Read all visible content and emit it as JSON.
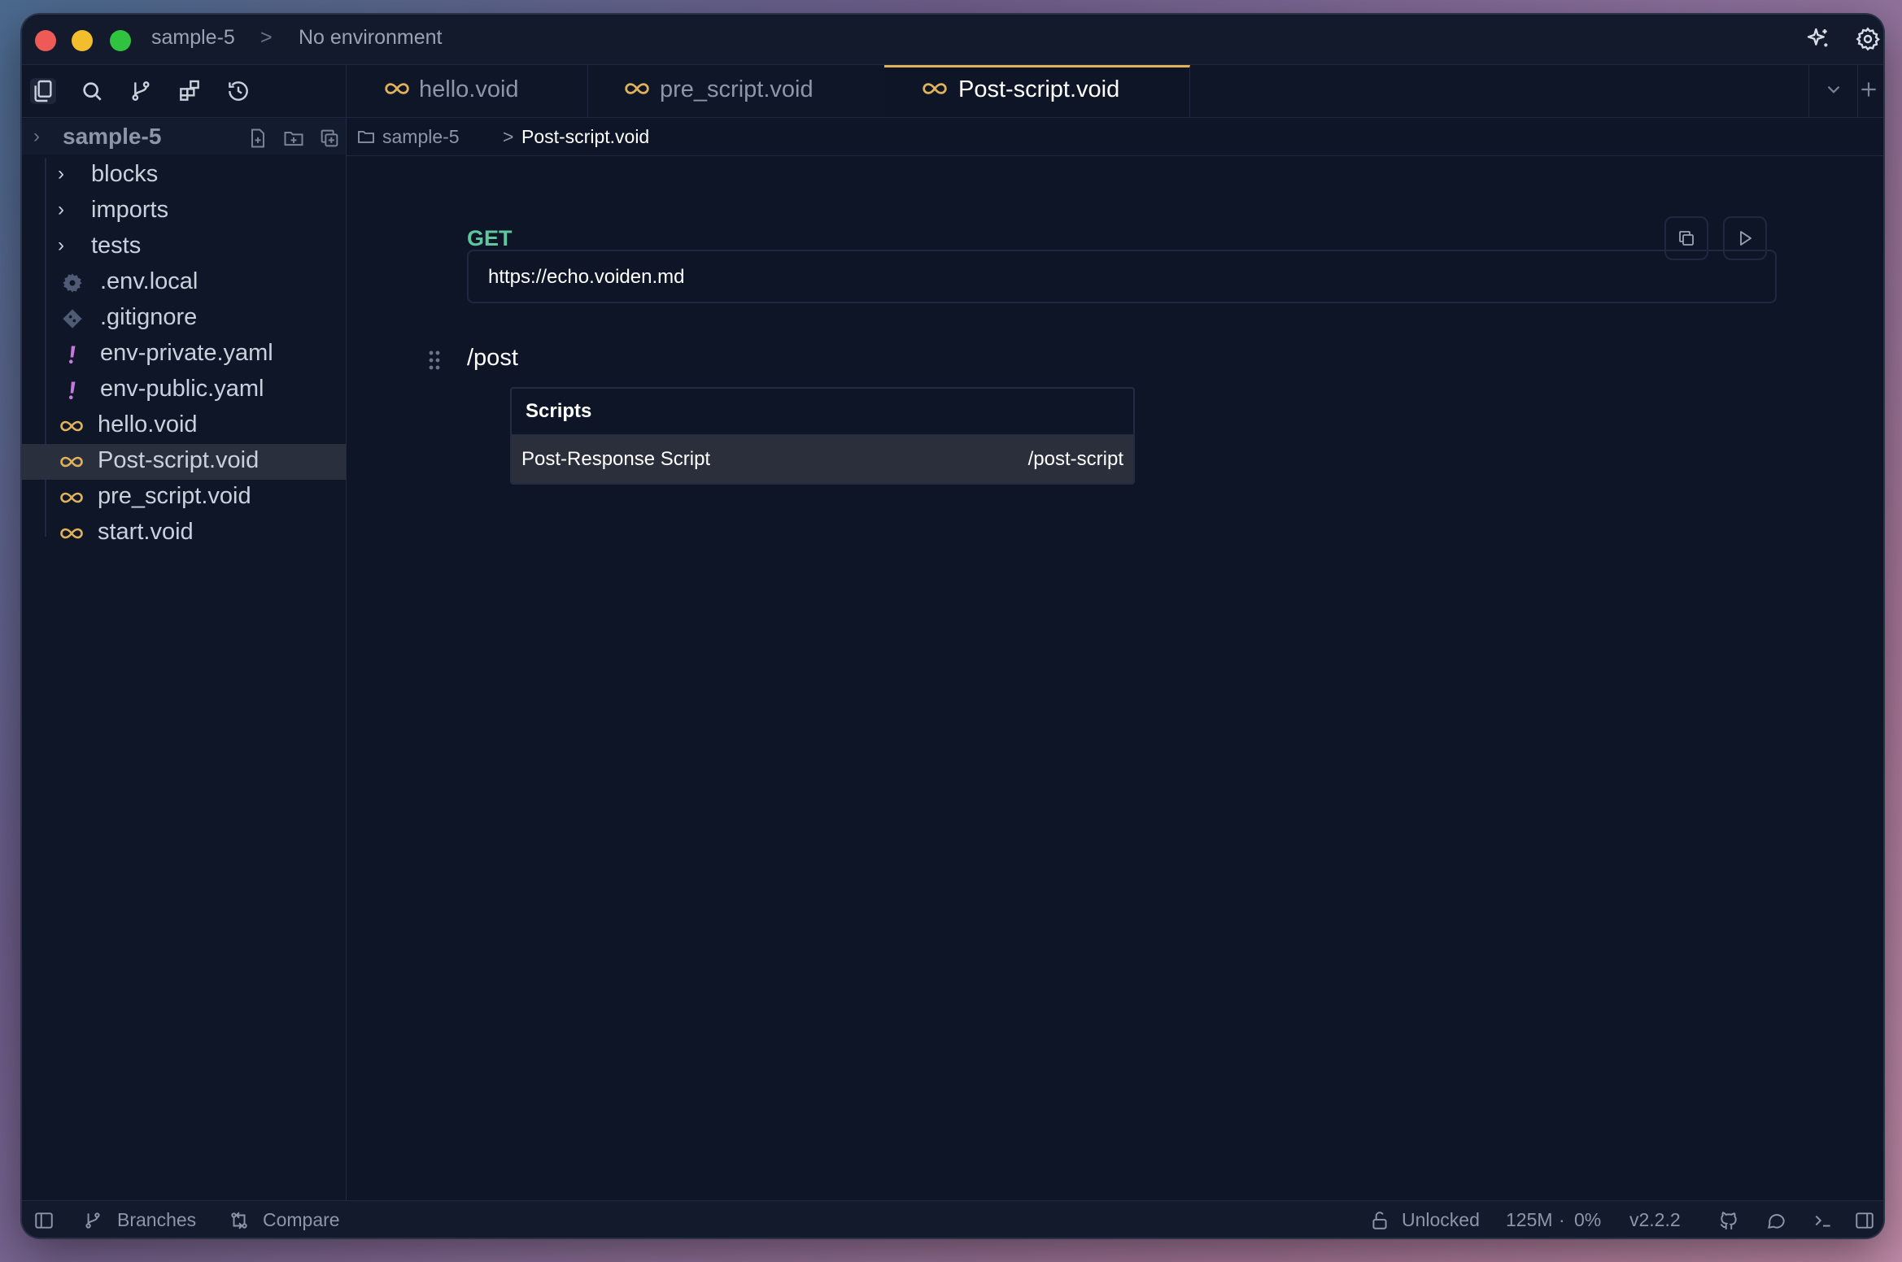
{
  "titlebar": {
    "project": "sample-5",
    "separator": ">",
    "environment": "No environment",
    "icons": [
      "sparkle-icon",
      "settings-gear-icon"
    ]
  },
  "activity_bar": {
    "icons": [
      "files-icon",
      "search-icon",
      "source-control-icon",
      "extensions-icon",
      "history-icon"
    ],
    "active": "files-icon"
  },
  "sidebar": {
    "project_name": "sample-5",
    "project_tools": [
      "new-file-icon",
      "new-folder-icon",
      "duplicate-icon"
    ],
    "items": [
      {
        "label": "blocks",
        "type": "folder"
      },
      {
        "label": "imports",
        "type": "folder"
      },
      {
        "label": "tests",
        "type": "folder"
      },
      {
        "label": ".env.local",
        "type": "gear"
      },
      {
        "label": ".gitignore",
        "type": "git"
      },
      {
        "label": "env-private.yaml",
        "type": "yaml"
      },
      {
        "label": "env-public.yaml",
        "type": "yaml"
      },
      {
        "label": "hello.void",
        "type": "void"
      },
      {
        "label": "Post-script.void",
        "type": "void",
        "selected": true
      },
      {
        "label": "pre_script.void",
        "type": "void"
      },
      {
        "label": "start.void",
        "type": "void"
      }
    ]
  },
  "tabs": [
    {
      "label": "hello.void",
      "active": false
    },
    {
      "label": "pre_script.void",
      "active": false
    },
    {
      "label": "Post-script.void",
      "active": true
    }
  ],
  "breadcrumb": {
    "folder": "sample-5",
    "separator": ">",
    "file": "Post-script.void"
  },
  "editor": {
    "method": "GET",
    "url": "https://echo.voiden.md",
    "path": "/post",
    "scripts_panel": {
      "title": "Scripts",
      "items": [
        {
          "label": "Post-Response Script",
          "command": "/post-script"
        }
      ]
    }
  },
  "statusbar": {
    "branches": "Branches",
    "compare": "Compare",
    "lock_state": "Unlocked",
    "memory": "125M",
    "dot": "·",
    "cpu": "0%",
    "version": "v2.2.2"
  },
  "colors": {
    "accent_tab": "#e0b25a",
    "method_get": "#5ec79d",
    "void_icon": "#e0b25a",
    "yaml_icon": "#c678dd",
    "background": "#0e1527"
  }
}
